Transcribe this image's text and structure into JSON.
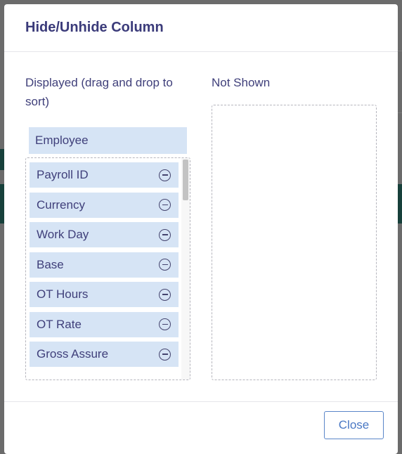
{
  "modal": {
    "title": "Hide/Unhide Column",
    "displayed_label": "Displayed (drag and drop to sort)",
    "hidden_label": "Not Shown",
    "pinned_column": "Employee",
    "displayed_columns": [
      {
        "label": "Payroll ID",
        "action_icon": "minus-circle-icon"
      },
      {
        "label": "Currency",
        "action_icon": "minus-circle-icon"
      },
      {
        "label": "Work Day",
        "action_icon": "minus-circle-icon"
      },
      {
        "label": "Base",
        "action_icon": "minus-circle-icon"
      },
      {
        "label": "OT Hours",
        "action_icon": "minus-circle-icon"
      },
      {
        "label": "OT Rate",
        "action_icon": "minus-circle-icon"
      },
      {
        "label": "Gross Assure",
        "action_icon": "minus-circle-icon"
      }
    ],
    "hidden_columns": [],
    "close_label": "Close"
  },
  "colors": {
    "overlay": "#6b6b6b",
    "title": "#3b3b7a",
    "item_background": "#d6e4f5",
    "close_accent": "#4a78c4",
    "backdrop_teal": "#17403b"
  }
}
